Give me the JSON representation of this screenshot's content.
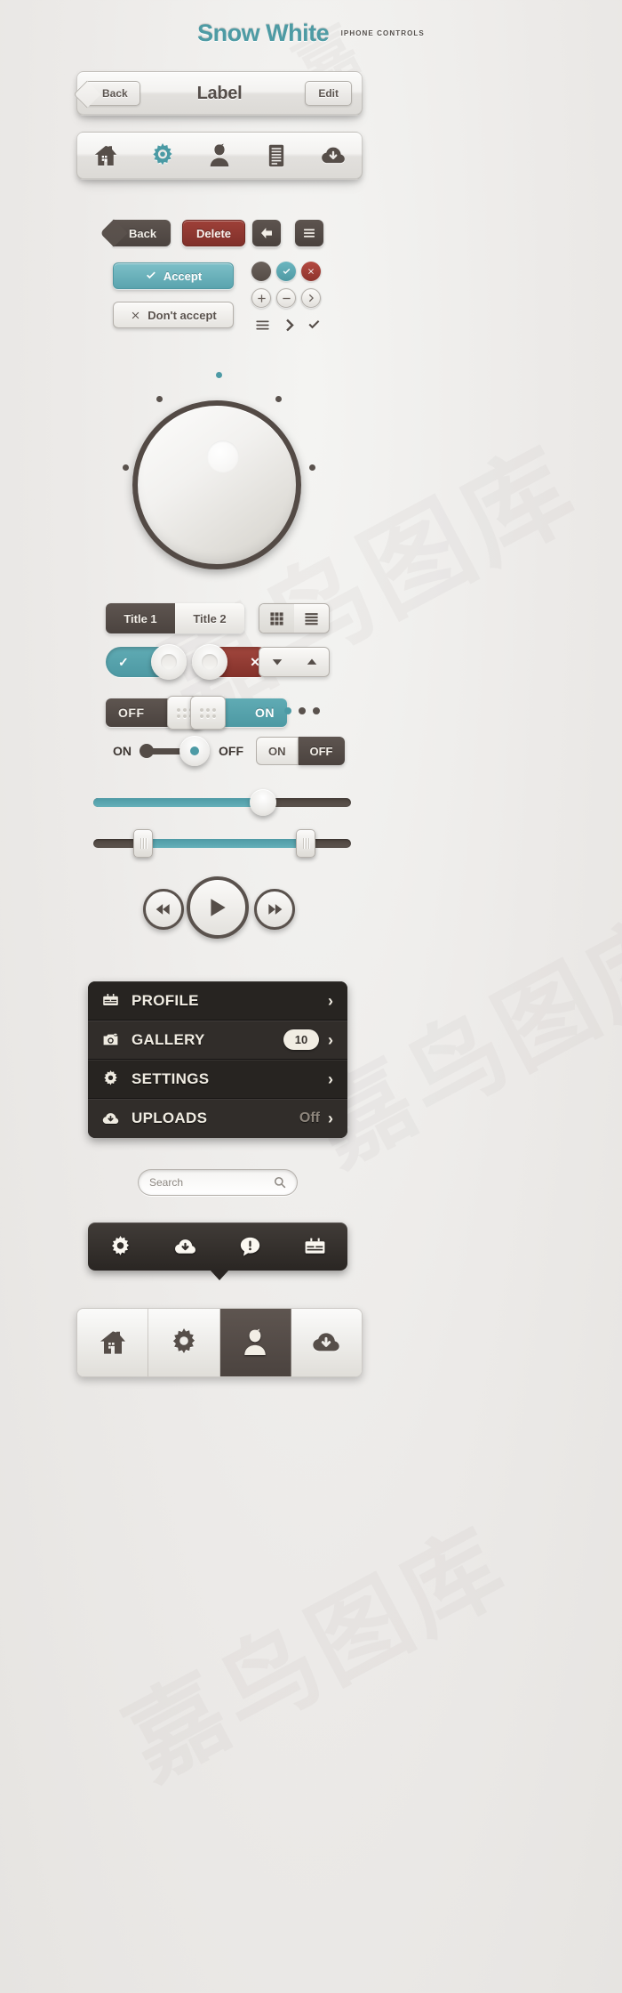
{
  "header": {
    "brand": "Snow White",
    "subtitle": "IPHONE CONTROLS"
  },
  "navbar": {
    "back_label": "Back",
    "title": "Label",
    "edit_label": "Edit"
  },
  "tabbar": {
    "items": [
      {
        "icon": "home-icon",
        "active": false
      },
      {
        "icon": "gear-icon",
        "active": true
      },
      {
        "icon": "person-icon",
        "active": false
      },
      {
        "icon": "document-icon",
        "active": false
      },
      {
        "icon": "cloud-download-icon",
        "active": false
      }
    ]
  },
  "buttons": {
    "back_label": "Back",
    "delete_label": "Delete",
    "accept_label": "Accept",
    "decline_label": "Don't accept",
    "accept_icon": "check-icon",
    "decline_icon": "close-icon",
    "arrow_left_icon": "arrow-left-icon",
    "hamburger_icon": "hamburger-icon",
    "circle_icons": [
      "dot-icon",
      "check-icon",
      "close-icon",
      "plus-icon",
      "minus-icon",
      "chevron-right-icon"
    ],
    "mini_icons": [
      "list-icon",
      "chevron-right-icon",
      "check-icon"
    ]
  },
  "knob": {
    "value_dot_position": "top",
    "tick_count": 6
  },
  "segmented": {
    "title1": "Title 1",
    "title2": "Title 2",
    "selected": "Title 1"
  },
  "viewtoggle": {
    "grid_icon": "grid-icon",
    "list-icon": "list-icon",
    "selected": "grid"
  },
  "toggles": {
    "on": {
      "state": "on",
      "icon": "check-icon",
      "color": "#4d99a3"
    },
    "off": {
      "state": "off",
      "icon": "close-icon",
      "color": "#84322b"
    }
  },
  "stepper": {
    "up_icon": "triangle-down-icon",
    "down_icon": "triangle-up-icon"
  },
  "slideswitch": {
    "left": {
      "label": "OFF",
      "state": "off"
    },
    "right": {
      "label": "ON",
      "state": "on"
    }
  },
  "pagedots": {
    "count": 3,
    "active_index": 0
  },
  "pillslider": {
    "left_label": "ON",
    "right_label": "OFF",
    "position": "right"
  },
  "onoffbuttons": {
    "on_label": "ON",
    "off_label": "OFF",
    "selected": "OFF"
  },
  "sliders": {
    "single": {
      "value_percent": 65
    },
    "range": {
      "low_percent": 17,
      "high_percent": 80
    }
  },
  "media": {
    "prev_icon": "rewind-icon",
    "play_icon": "play-icon",
    "next_icon": "fast-forward-icon"
  },
  "menu": {
    "items": [
      {
        "label": "PROFILE",
        "icon": "wallet-icon",
        "badge": "",
        "meta": "",
        "chevron": "›"
      },
      {
        "label": "GALLERY",
        "icon": "camera-icon",
        "badge": "10",
        "meta": "",
        "chevron": "›"
      },
      {
        "label": "SETTINGS",
        "icon": "gear-icon",
        "badge": "",
        "meta": "",
        "chevron": "›"
      },
      {
        "label": "UPLOADS",
        "icon": "cloud-download-icon",
        "badge": "",
        "meta": "Off",
        "chevron": "›"
      }
    ]
  },
  "search": {
    "placeholder": "Search",
    "value": "Search",
    "icon": "magnifier-icon"
  },
  "popover": {
    "items": [
      {
        "icon": "gear-icon"
      },
      {
        "icon": "cloud-download-icon"
      },
      {
        "icon": "alert-icon"
      },
      {
        "icon": "wallet-icon"
      }
    ]
  },
  "bottombar": {
    "items": [
      {
        "icon": "home-icon",
        "selected": false
      },
      {
        "icon": "gear-icon",
        "selected": false
      },
      {
        "icon": "person-icon",
        "selected": true
      },
      {
        "icon": "cloud-download-icon",
        "selected": false
      }
    ]
  },
  "colors": {
    "accent_teal": "#4d99a3",
    "danger_red": "#8d332c",
    "dark": "#4b433f",
    "bg": "#eeeeec"
  }
}
